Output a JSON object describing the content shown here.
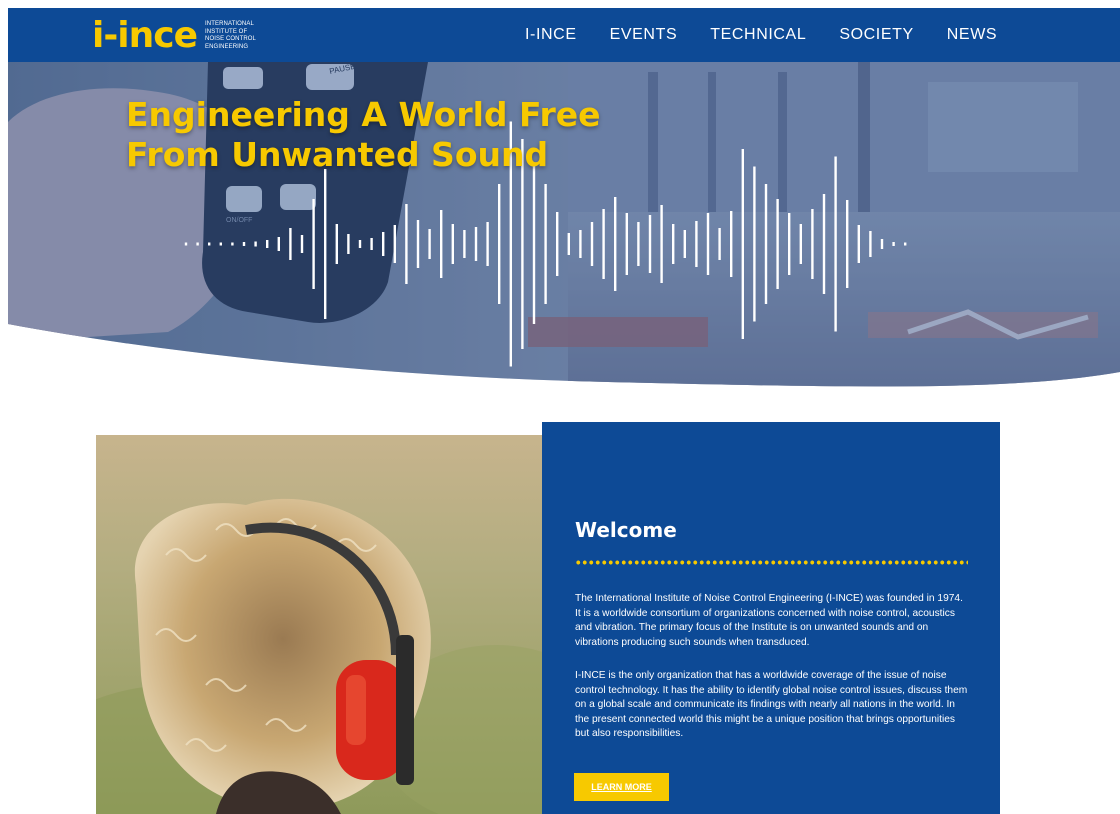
{
  "brand": {
    "logo_text": "i-ince",
    "logo_subtitle": "INTERNATIONAL INSTITUTE OF NOISE CONTROL ENGINEERING"
  },
  "nav": {
    "items": [
      {
        "label": "I-INCE"
      },
      {
        "label": "EVENTS"
      },
      {
        "label": "TECHNICAL"
      },
      {
        "label": "SOCIETY"
      },
      {
        "label": "NEWS"
      }
    ]
  },
  "hero": {
    "title_line1": "Engineering A World Free",
    "title_line2": "From Unwanted Sound",
    "device_labels": {
      "pause": "PAUSE",
      "onoff": "ON/OFF"
    }
  },
  "welcome": {
    "title": "Welcome",
    "paragraph1": "The International Institute of Noise Control Engineering (I-INCE) was founded in 1974. It is a worldwide consortium of organizations concerned with noise control, acoustics and vibration. The primary focus of the Institute is on unwanted sounds and on vibrations producing such sounds when transduced.",
    "paragraph2": "I-INCE is the only organization that has a worldwide coverage of the issue of noise control technology. It has the ability to identify global noise control issues, discuss them on a global scale and communicate its findings with nearly all nations in the world. In the present connected world this might be a unique position that brings opportunities but also responsibilities.",
    "button_label": "LEARN MORE"
  },
  "colors": {
    "brand_blue": "#0d4a96",
    "brand_yellow": "#f7c900"
  }
}
